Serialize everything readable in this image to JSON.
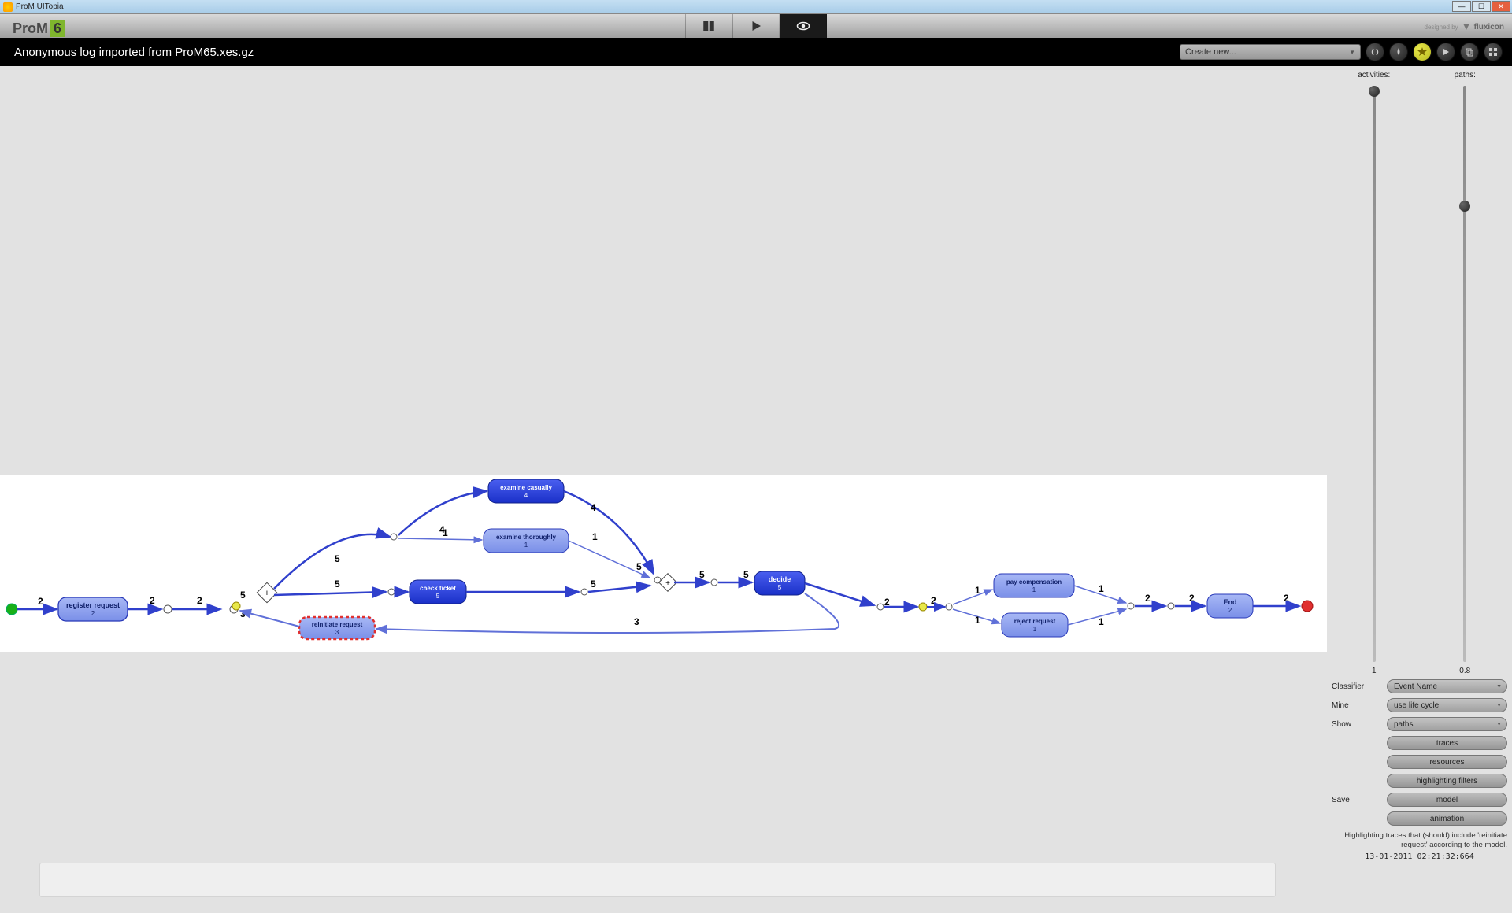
{
  "window": {
    "title": "ProM UITopia"
  },
  "logo": {
    "name": "ProM",
    "version": "6"
  },
  "footer_brand": {
    "prefix": "designed by",
    "name": "fluxicon"
  },
  "header": {
    "log_title": "Anonymous log imported from ProM65.xes.gz",
    "create_label": "Create new..."
  },
  "sliders": {
    "activities": {
      "label": "activities:",
      "value": "1",
      "thumb_pct": 0
    },
    "paths": {
      "label": "paths:",
      "value": "0.8",
      "thumb_pct": 20
    }
  },
  "controls": {
    "classifier": {
      "label": "Classifier",
      "value": "Event Name"
    },
    "mine": {
      "label": "Mine",
      "value": "use life cycle"
    },
    "show": {
      "label": "Show",
      "value": "paths"
    },
    "traces_btn": "traces",
    "resources_btn": "resources",
    "highlight_btn": "highlighting filters",
    "save_label": "Save",
    "model_btn": "model",
    "animation_btn": "animation"
  },
  "message": "Highlighting traces that (should) include 'reinitiate request' according to the model.",
  "timestamp": "13-01-2011 02:21:32:664",
  "help": "?",
  "graph": {
    "nodes": {
      "register": {
        "label": "register request",
        "count": "2"
      },
      "reinitiate": {
        "label": "reinitiate request",
        "count": "3"
      },
      "check": {
        "label": "check ticket",
        "count": "5"
      },
      "casually": {
        "label": "examine casually",
        "count": "4"
      },
      "thoroughly": {
        "label": "examine thoroughly",
        "count": "1"
      },
      "decide": {
        "label": "decide",
        "count": "5"
      },
      "paycomp": {
        "label": "pay compensation",
        "count": "1"
      },
      "reject": {
        "label": "reject request",
        "count": "1"
      },
      "end": {
        "label": "End",
        "count": "2"
      }
    },
    "edges": {
      "e1": "2",
      "e2": "2",
      "e3": "2",
      "e4": "5",
      "e5": "3",
      "e6": "5",
      "e7": "4",
      "e8": "5",
      "e9": "1",
      "e10": "4",
      "e11": "1",
      "e12": "5",
      "e13": "5",
      "e14": "5",
      "e15": "5",
      "e16": "3",
      "e17": "2",
      "e18": "2",
      "e19": "1",
      "e20": "1",
      "e21": "1",
      "e22": "1",
      "e23": "2",
      "e24": "2",
      "e25": "2"
    }
  }
}
